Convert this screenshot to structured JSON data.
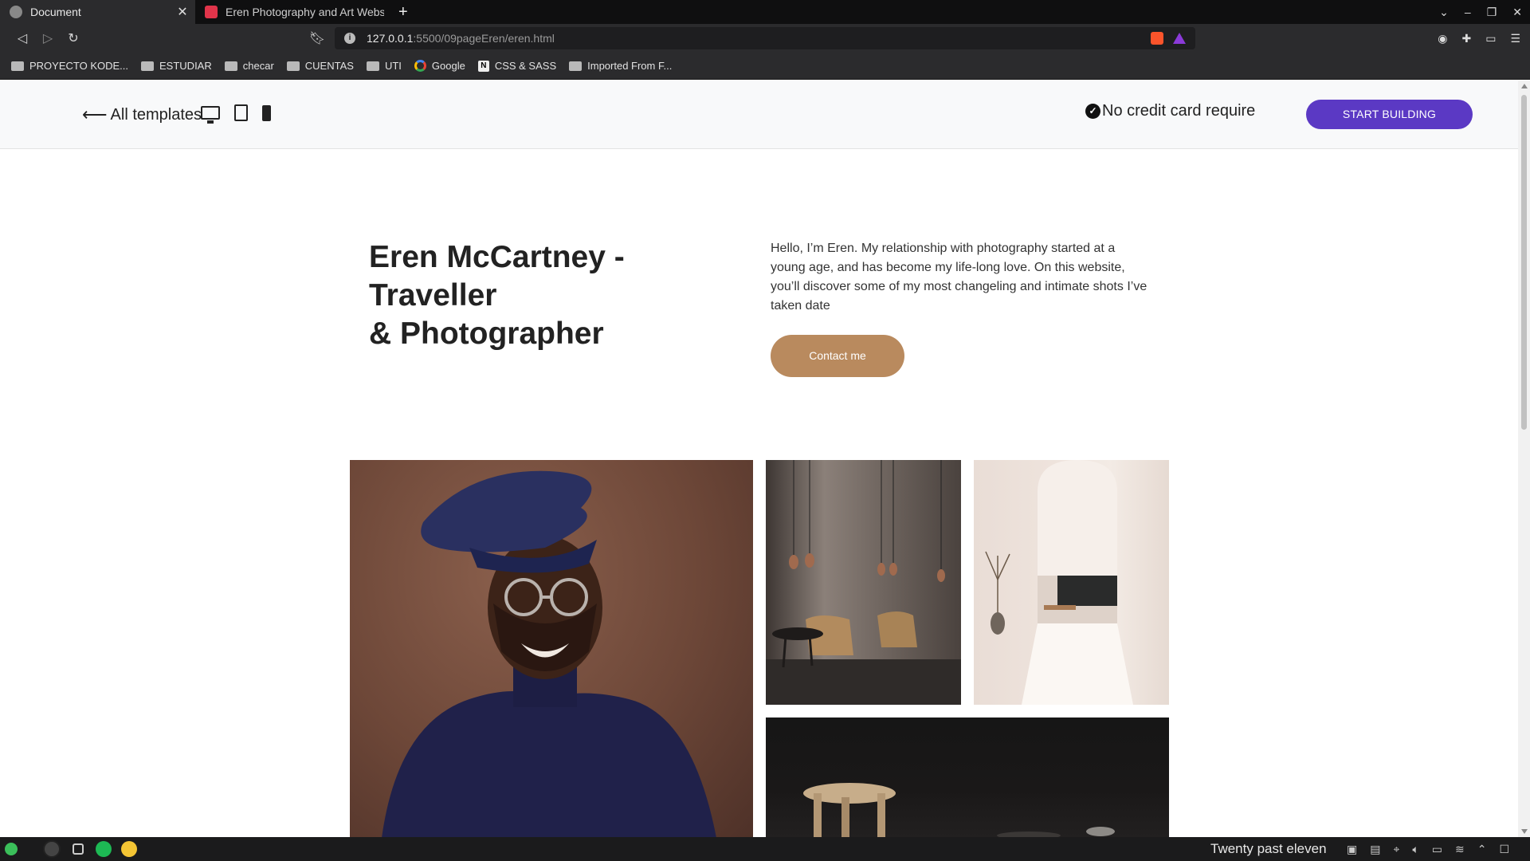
{
  "browser": {
    "tabs": [
      {
        "title": "Document",
        "active": true
      },
      {
        "title": "Eren Photography and Art Websit",
        "active": false
      }
    ],
    "url_host": "127.0.0.1",
    "url_path": ":5500/09pageEren/eren.html",
    "bookmarks": [
      {
        "label": "PROYECTO KODE...",
        "icon": "folder-icon"
      },
      {
        "label": "ESTUDIAR",
        "icon": "folder-icon"
      },
      {
        "label": "checar",
        "icon": "folder-icon"
      },
      {
        "label": "CUENTAS",
        "icon": "folder-icon"
      },
      {
        "label": "UTI",
        "icon": "folder-icon"
      },
      {
        "label": "Google",
        "icon": "google-icon"
      },
      {
        "label": "CSS & SASS",
        "icon": "notion-icon"
      },
      {
        "label": "Imported From F...",
        "icon": "folder-icon"
      }
    ]
  },
  "topbar": {
    "back_label": "All templates",
    "nocredit_label": "No credit card require",
    "start_label": "START BUILDING",
    "accent_color": "#5b39c4"
  },
  "hero": {
    "title_line1": "Eren McCartney -",
    "title_line2": "Traveller",
    "title_line3": "& Photographer",
    "intro": "Hello, I’m Eren. My relationship with photography started at a young age, and has become my life-long love. On this website, you’ll discover some of my most changeling and intimate shots I’ve taken date",
    "contact_label": "Contact me",
    "contact_color": "#b98a5e"
  },
  "taskbar": {
    "clock": "Twenty past eleven"
  }
}
